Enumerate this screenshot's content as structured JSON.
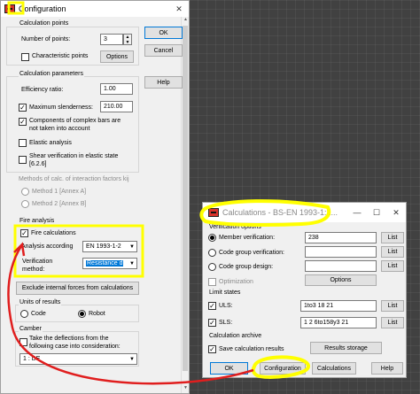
{
  "config_window": {
    "title": "Configuration",
    "calc_points": {
      "group_label": "Calculation points",
      "num_points_label": "Number of points:",
      "num_points_value": "3",
      "char_points_label": "Characteristic points",
      "char_points_checked": false,
      "options_button": "Options"
    },
    "calc_params": {
      "group_label": "Calculation parameters",
      "efficiency_label": "Efficiency ratio:",
      "efficiency_value": "1.00",
      "max_slenderness_label": "Maximum slenderness:",
      "max_slenderness_checked": true,
      "max_slenderness_value": "210.00",
      "complex_bars_label_1": "Components of complex bars are",
      "complex_bars_label_2": "not taken into account",
      "complex_bars_checked": true,
      "elastic_label": "Elastic analysis",
      "elastic_checked": false,
      "shear_label_1": "Shear verification in elastic state",
      "shear_label_2": "[6.2.6]",
      "shear_checked": false
    },
    "methods": {
      "group_label": "Methods of calc. of interaction factors kij",
      "method1": "Method 1 [Annex A]",
      "method2": "Method 2 [Annex B]"
    },
    "fire": {
      "group_label": "Fire analysis",
      "fire_calc_label": "Fire calculations",
      "fire_calc_checked": true,
      "analysis_label": "Analysis according",
      "analysis_value": "EN 1993-1-2",
      "verification_label_1": "Verification",
      "verification_label_2": "method:",
      "verification_value": "Resistance d"
    },
    "exclude_button": "Exclude internal forces from calculations",
    "units": {
      "group_label": "Units of results",
      "code_label": "Code",
      "robot_label": "Robot",
      "selected": "Robot"
    },
    "camber": {
      "group_label": "Camber",
      "deflection_label_1": "Take the deflections from the",
      "deflection_label_2": "following case into consideration:",
      "deflection_checked": false,
      "case_value": "1 : DE"
    },
    "buttons": {
      "ok": "OK",
      "cancel": "Cancel",
      "help": "Help"
    }
  },
  "calc_window": {
    "title": "Calculations - BS-EN 1993-1:2...",
    "verification_options": {
      "group_label": "Verification options",
      "member_label": "Member verification:",
      "member_value": "238",
      "code_group_label": "Code group verification:",
      "code_group_value": "",
      "code_group_design_label": "Code group design:",
      "code_group_design_value": "",
      "optimization_label": "Optimization",
      "options_button": "Options",
      "list_button": "List",
      "selected": "Member verification"
    },
    "limit_states": {
      "group_label": "Limit states",
      "uls_label": "ULS:",
      "uls_checked": true,
      "uls_value": "1to3 18 21",
      "sls_label": "SLS:",
      "sls_checked": true,
      "sls_value": "1 2 6to158y3 21",
      "list_button": "List"
    },
    "archive": {
      "group_label": "Calculation archive",
      "save_label": "Save calculation results",
      "save_checked": true,
      "storage_button": "Results storage"
    },
    "buttons": {
      "ok": "OK",
      "configuration": "Configuration",
      "calculations": "Calculations",
      "help": "Help"
    }
  },
  "colors": {
    "highlight": "#ffff00",
    "annotation": "#e01e1e",
    "accent": "#0078d7"
  }
}
